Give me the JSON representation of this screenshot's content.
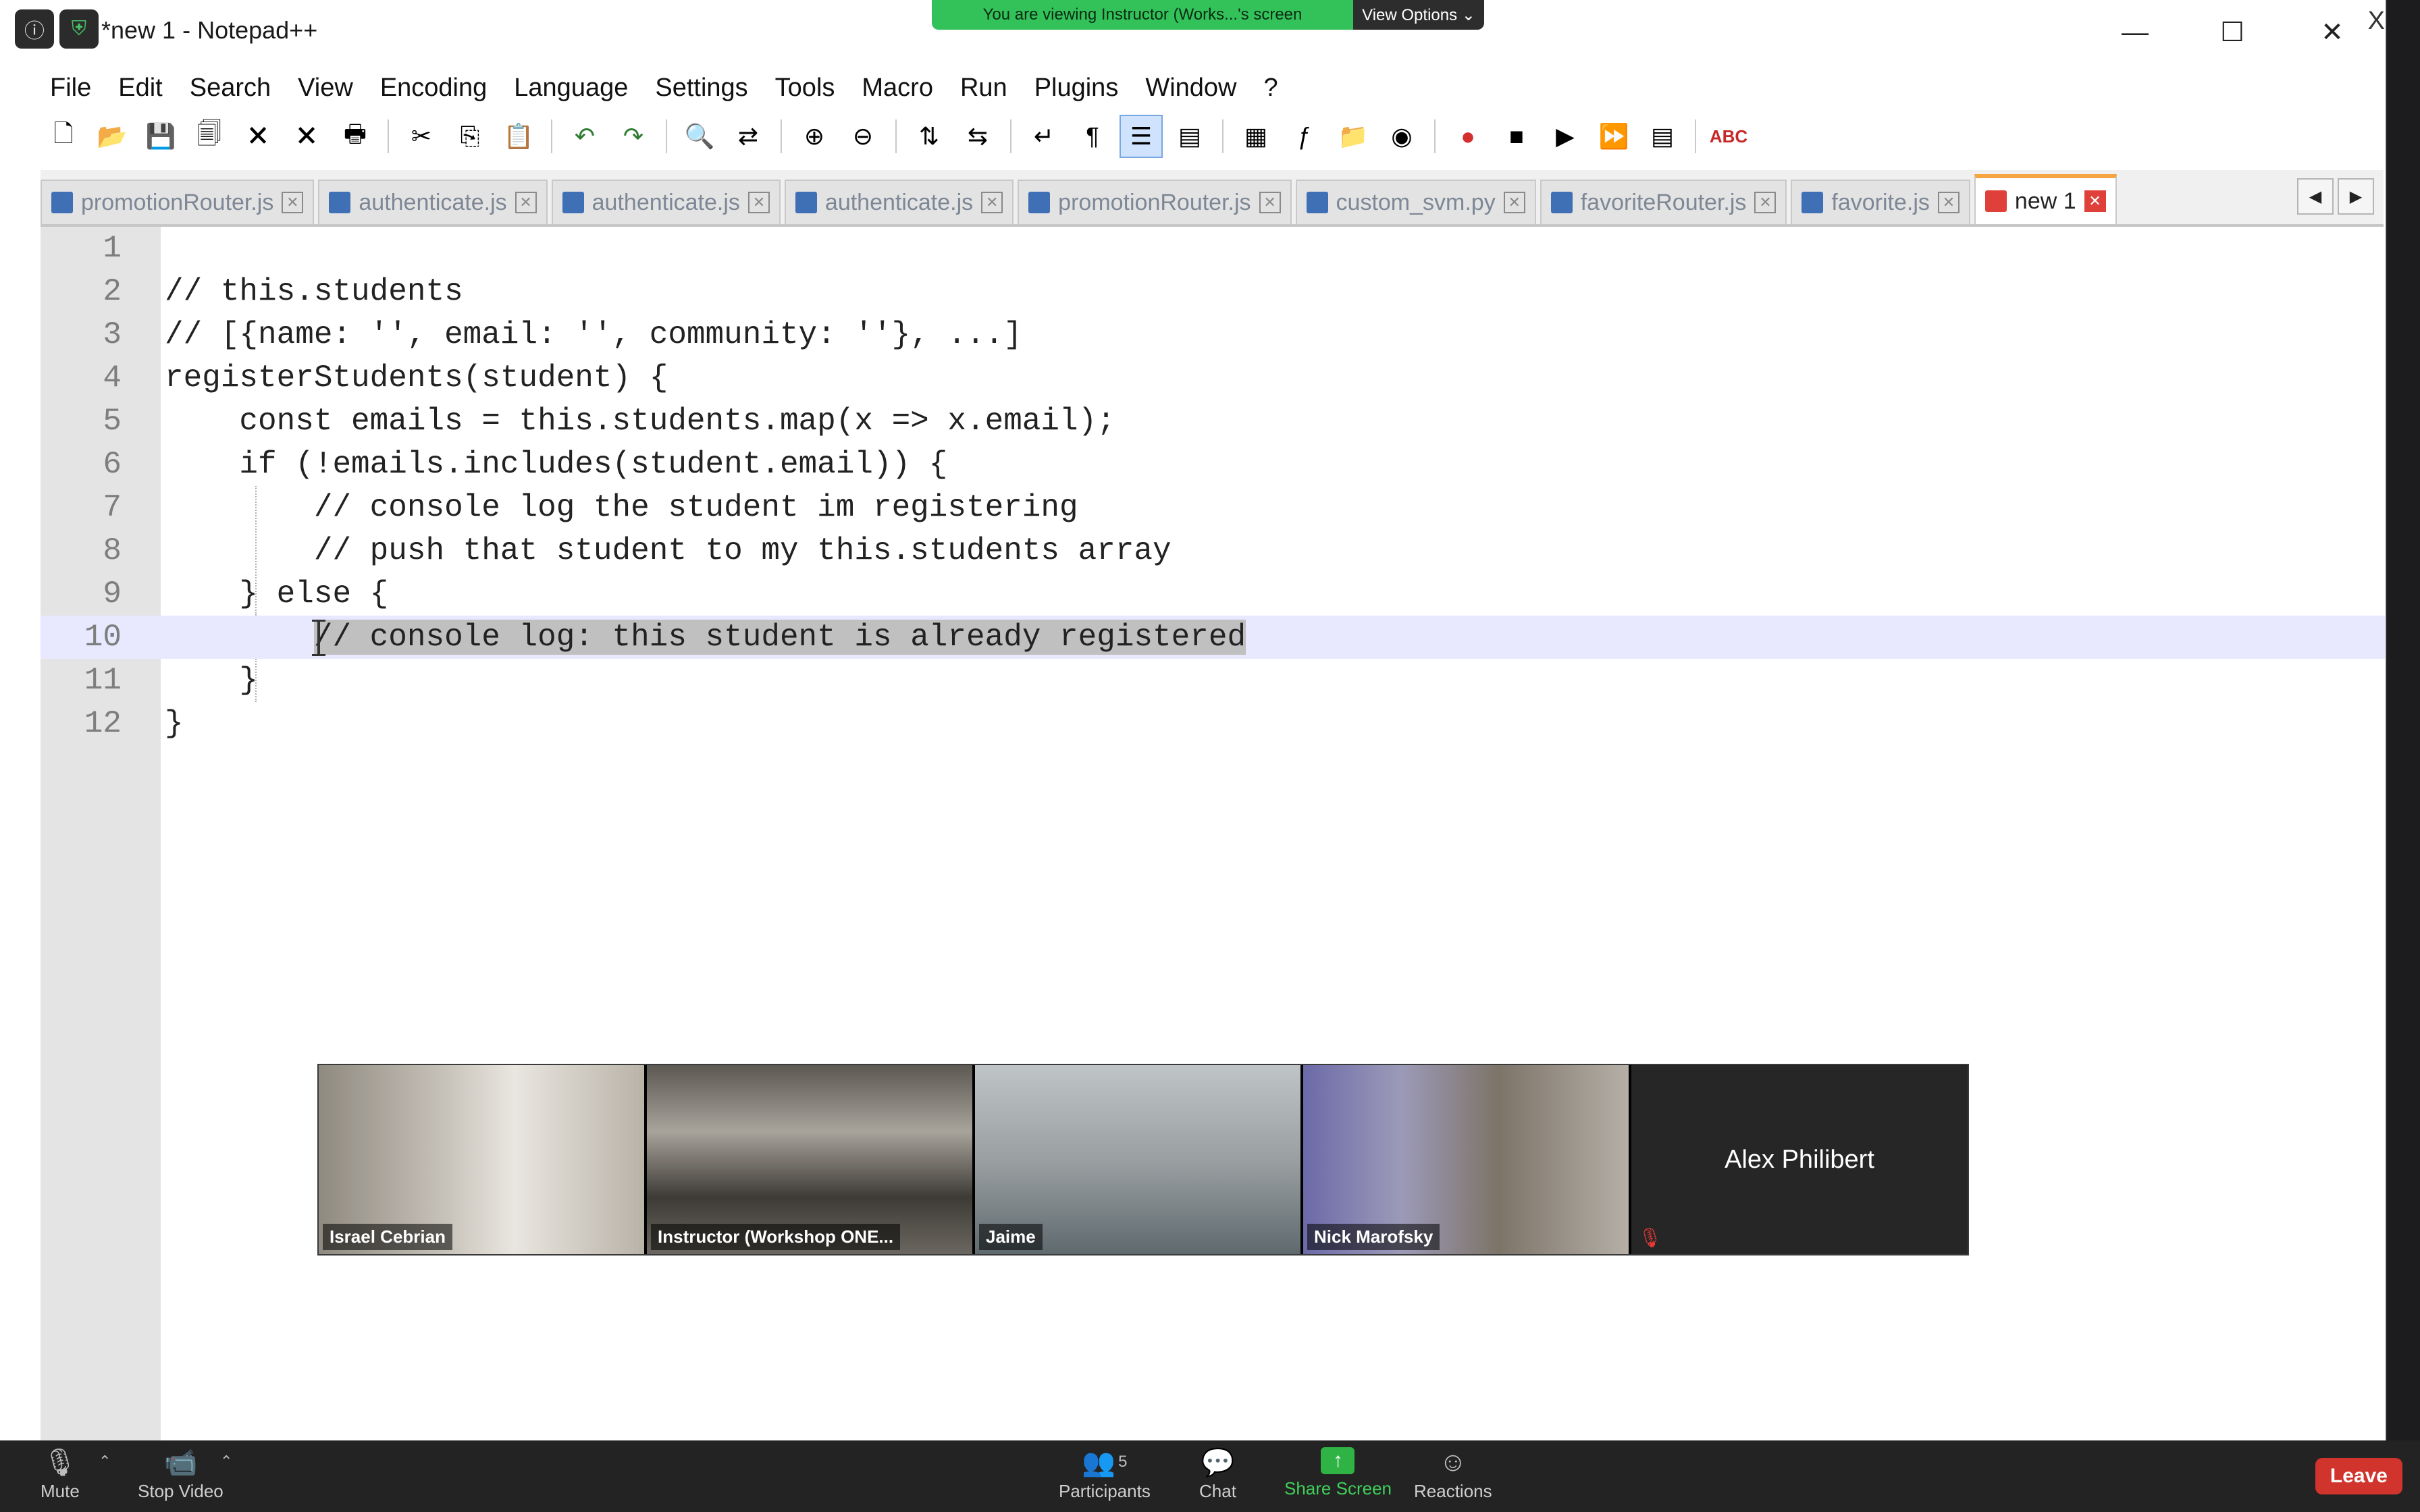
{
  "window": {
    "title": "*new 1 - Notepad++"
  },
  "share_banner": {
    "text": "You are viewing Instructor (Works...'s screen",
    "view_options": "View Options ⌄"
  },
  "menu": [
    "File",
    "Edit",
    "Search",
    "View",
    "Encoding",
    "Language",
    "Settings",
    "Tools",
    "Macro",
    "Run",
    "Plugins",
    "Window",
    "?"
  ],
  "menu_close": "X",
  "toolbar_icons": [
    "new-file-icon",
    "open-file-icon",
    "save-icon",
    "save-all-icon",
    "close-icon",
    "close-all-icon",
    "print-icon",
    "cut-icon",
    "copy-icon",
    "paste-icon",
    "undo-icon",
    "redo-icon",
    "find-icon",
    "replace-icon",
    "zoom-in-icon",
    "zoom-out-icon",
    "sync-vertical-icon",
    "sync-horizontal-icon",
    "word-wrap-icon",
    "show-all-chars-icon",
    "indent-guide-icon",
    "user-language-icon",
    "doc-map-icon",
    "function-list-icon",
    "folder-workspace-icon",
    "monitoring-icon",
    "record-macro-icon",
    "stop-macro-icon",
    "play-macro-icon",
    "run-multiple-macro-icon",
    "save-macro-icon",
    "spell-check-icon"
  ],
  "tabs": [
    {
      "label": "promotionRouter.js",
      "active": false
    },
    {
      "label": "authenticate.js",
      "active": false
    },
    {
      "label": "authenticate.js",
      "active": false
    },
    {
      "label": "authenticate.js",
      "active": false
    },
    {
      "label": "promotionRouter.js",
      "active": false
    },
    {
      "label": "custom_svm.py",
      "active": false
    },
    {
      "label": "favoriteRouter.js",
      "active": false
    },
    {
      "label": "favorite.js",
      "active": false
    },
    {
      "label": "new 1",
      "active": true
    }
  ],
  "tab_close": "✕",
  "tab_arrows": [
    "◀",
    "▶"
  ],
  "code_lines": [
    {
      "no": "1",
      "text": ""
    },
    {
      "no": "2",
      "text": "// this.students"
    },
    {
      "no": "3",
      "text": "// [{name: '', email: '', community: ''}, ...]"
    },
    {
      "no": "4",
      "text": "registerStudents(student) {"
    },
    {
      "no": "5",
      "text": "    const emails = this.students.map(x => x.email);"
    },
    {
      "no": "6",
      "text": "    if (!emails.includes(student.email)) {"
    },
    {
      "no": "7",
      "text": "        // console log the student im registering"
    },
    {
      "no": "8",
      "text": "        // push that student to my this.students array"
    },
    {
      "no": "9",
      "text": "    } else {"
    },
    {
      "no": "10",
      "text": "        // console log: this student is already registered"
    },
    {
      "no": "11",
      "text": "    }"
    },
    {
      "no": "12",
      "text": "}"
    }
  ],
  "video_tiles": [
    {
      "name": "Israel Cebrian",
      "active": false
    },
    {
      "name": "Instructor (Workshop ONE...",
      "active": false
    },
    {
      "name": "Jaime",
      "active": true
    },
    {
      "name": "Nick Marofsky",
      "active": false
    },
    {
      "name": "Alex Philibert",
      "active": false
    }
  ],
  "zoom_bar": {
    "mute": "Mute",
    "stop_video": "Stop Video",
    "participants": "Participants",
    "participants_count": "5",
    "chat": "Chat",
    "share_screen": "Share Screen",
    "reactions": "Reactions",
    "leave": "Leave"
  }
}
